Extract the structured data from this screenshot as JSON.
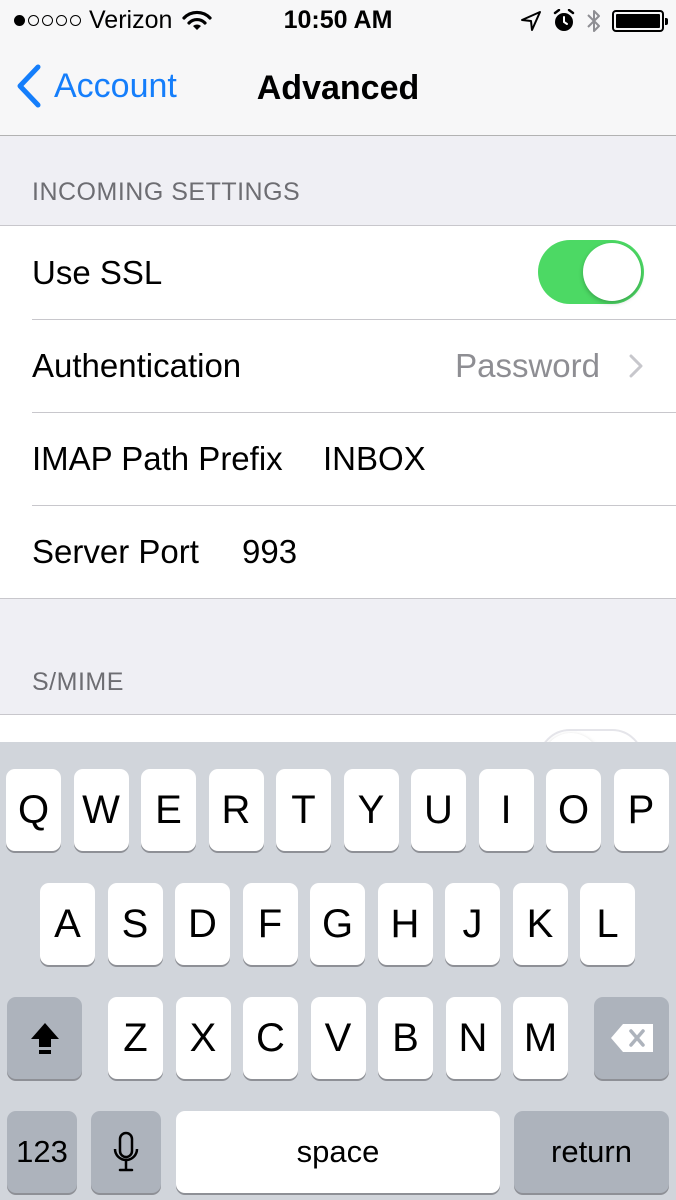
{
  "status_bar": {
    "carrier": "Verizon",
    "signal_bars": 1,
    "time": "10:50 AM",
    "battery_level": 1.0,
    "icons": [
      "wifi-icon",
      "location-arrow-icon",
      "alarm-icon",
      "bluetooth-icon",
      "battery-icon"
    ]
  },
  "nav": {
    "back_label": "Account",
    "title": "Advanced"
  },
  "incoming": {
    "header": "INCOMING SETTINGS",
    "use_ssl_label": "Use SSL",
    "use_ssl_on": true,
    "auth_label": "Authentication",
    "auth_value": "Password",
    "imap_label": "IMAP Path Prefix",
    "imap_value": "INBOX",
    "port_label": "Server Port",
    "port_value": "993"
  },
  "smime": {
    "header": "S/MIME",
    "toggle_on": false
  },
  "keyboard": {
    "row1": [
      "Q",
      "W",
      "E",
      "R",
      "T",
      "Y",
      "U",
      "I",
      "O",
      "P"
    ],
    "row2": [
      "A",
      "S",
      "D",
      "F",
      "G",
      "H",
      "J",
      "K",
      "L"
    ],
    "row3": [
      "Z",
      "X",
      "C",
      "V",
      "B",
      "N",
      "M"
    ],
    "numbers_label": "123",
    "space_label": "space",
    "return_label": "return"
  },
  "colors": {
    "accent": "#157efb",
    "toggle_on": "#4cd964",
    "group_background": "#efeff4",
    "keyboard_background": "#d1d5db"
  }
}
